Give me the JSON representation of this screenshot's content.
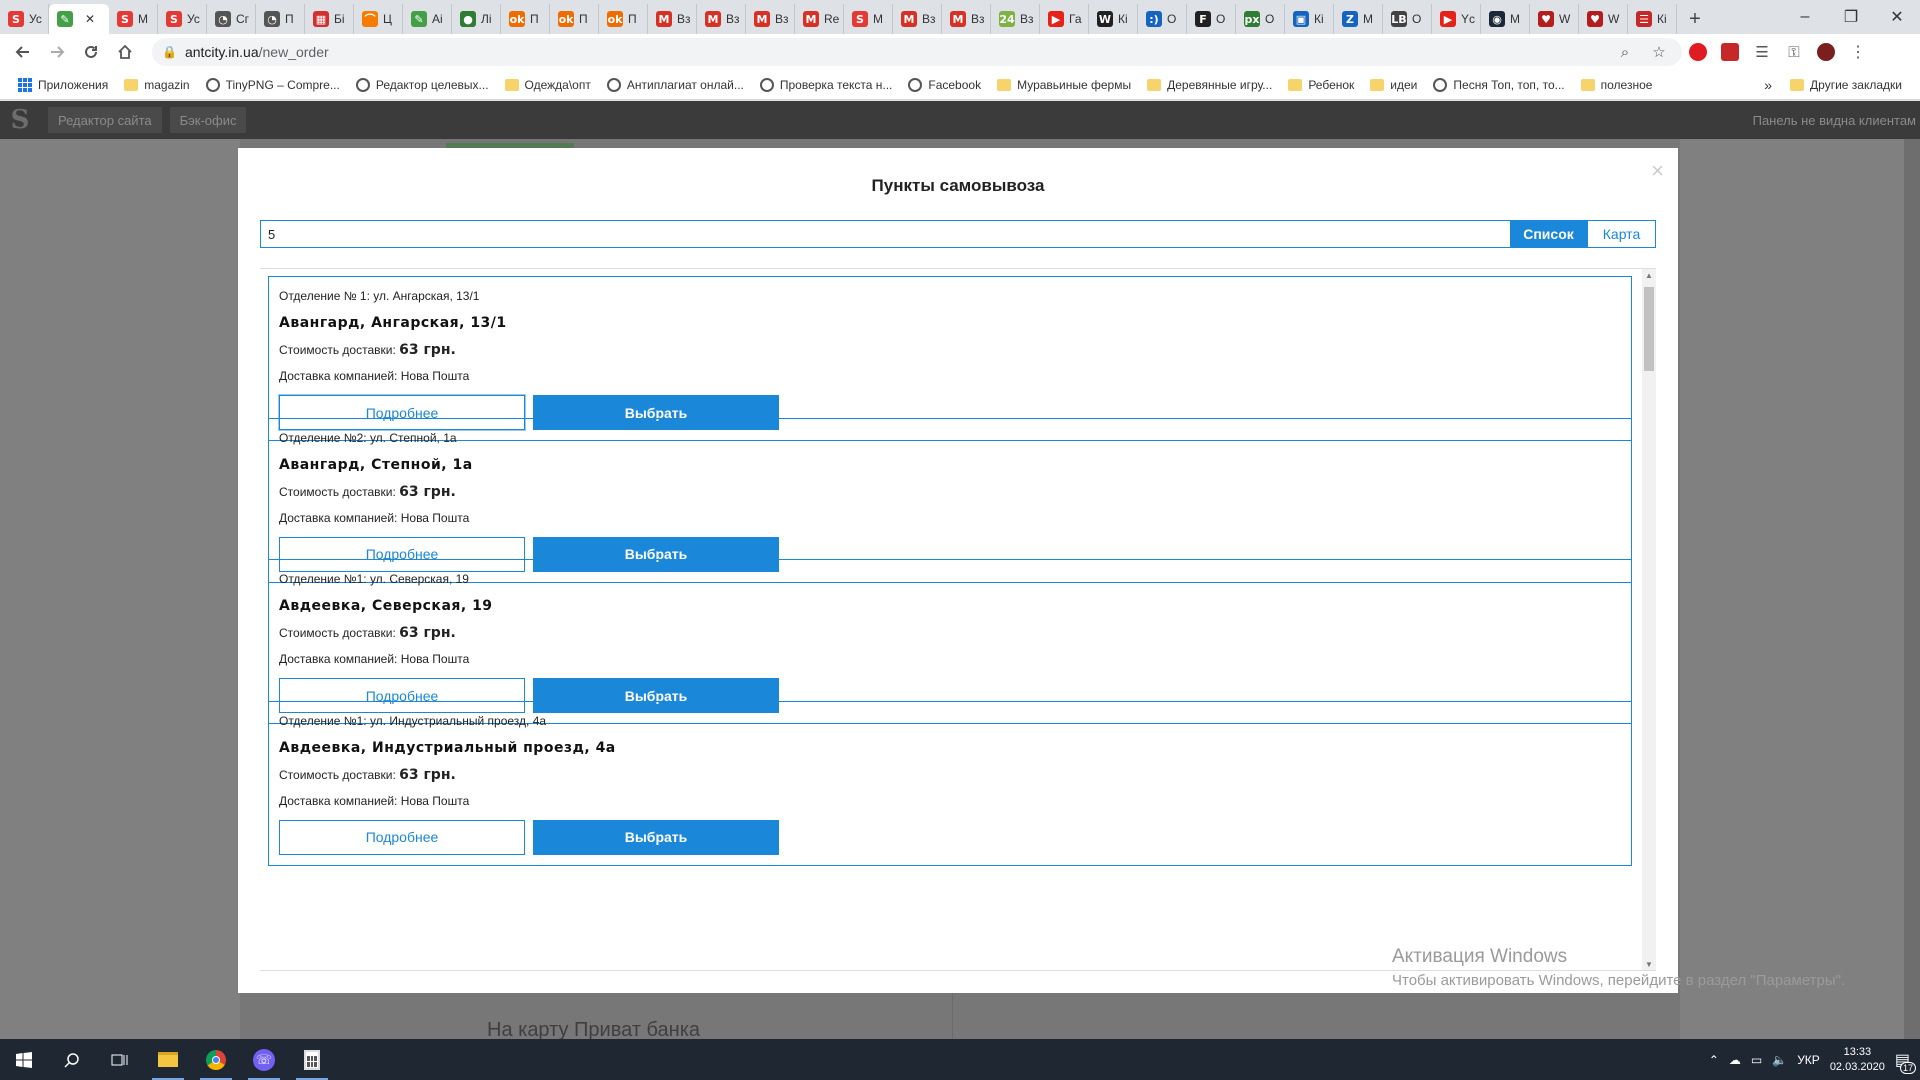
{
  "browser": {
    "tabs": [
      {
        "label": "Ус",
        "color": "#e53935",
        "glyph": "S"
      },
      {
        "label": "",
        "color": "#43a047",
        "glyph": "✎",
        "active": true
      },
      {
        "label": "М",
        "color": "#e53935",
        "glyph": "S"
      },
      {
        "label": "Ус",
        "color": "#e53935",
        "glyph": "S"
      },
      {
        "label": "Сг",
        "color": "#555555",
        "glyph": "◔"
      },
      {
        "label": "П",
        "color": "#555555",
        "glyph": "◔"
      },
      {
        "label": "Бі",
        "color": "#d32f2f",
        "glyph": "▦"
      },
      {
        "label": "Ц",
        "color": "#f57c00",
        "glyph": "⌒"
      },
      {
        "label": "Аі",
        "color": "#43a047",
        "glyph": "✎"
      },
      {
        "label": "Лі",
        "color": "#2e7d32",
        "glyph": "●"
      },
      {
        "label": "П",
        "color": "#ef6c00",
        "glyph": "ok"
      },
      {
        "label": "П",
        "color": "#ef6c00",
        "glyph": "ok"
      },
      {
        "label": "П",
        "color": "#ef6c00",
        "glyph": "ok"
      },
      {
        "label": "Вз",
        "color": "#d93025",
        "glyph": "M"
      },
      {
        "label": "Вз",
        "color": "#d93025",
        "glyph": "M"
      },
      {
        "label": "Вз",
        "color": "#d93025",
        "glyph": "M"
      },
      {
        "label": "Re",
        "color": "#d93025",
        "glyph": "M"
      },
      {
        "label": "М",
        "color": "#e53935",
        "glyph": "S"
      },
      {
        "label": "Вз",
        "color": "#d93025",
        "glyph": "M"
      },
      {
        "label": "Вз",
        "color": "#d93025",
        "glyph": "M"
      },
      {
        "label": "Вз",
        "color": "#7cb342",
        "glyph": "24"
      },
      {
        "label": "Га",
        "color": "#e62117",
        "glyph": "▶"
      },
      {
        "label": "Кі",
        "color": "#212121",
        "glyph": "W"
      },
      {
        "label": "О",
        "color": "#1565c0",
        "glyph": ":)"
      },
      {
        "label": "О",
        "color": "#212121",
        "glyph": "F"
      },
      {
        "label": "О",
        "color": "#2e7d32",
        "glyph": "px"
      },
      {
        "label": "Кі",
        "color": "#1565c0",
        "glyph": "▣"
      },
      {
        "label": "М",
        "color": "#1565c0",
        "glyph": "Z"
      },
      {
        "label": "О",
        "color": "#424242",
        "glyph": "LB"
      },
      {
        "label": "Yc",
        "color": "#e62117",
        "glyph": "▶"
      },
      {
        "label": "М",
        "color": "#1b2838",
        "glyph": "◉"
      },
      {
        "label": "W",
        "color": "#b71c1c",
        "glyph": "♥"
      },
      {
        "label": "W",
        "color": "#b71c1c",
        "glyph": "♥"
      },
      {
        "label": "Кі",
        "color": "#c62828",
        "glyph": "☰"
      }
    ],
    "window_controls": [
      "–",
      "❐",
      "✕"
    ],
    "url_domain": "antcity.in.ua",
    "url_path": "/new_order",
    "bookmarks": [
      {
        "label": "Приложения",
        "kind": "apps"
      },
      {
        "label": "magazin",
        "kind": "folder"
      },
      {
        "label": "TinyPNG – Compre...",
        "kind": "globe"
      },
      {
        "label": "Редактор целевых...",
        "kind": "globe"
      },
      {
        "label": "Одежда\\опт",
        "kind": "folder"
      },
      {
        "label": "Антиплагиат онлай...",
        "kind": "globe"
      },
      {
        "label": "Проверка текста н...",
        "kind": "globe"
      },
      {
        "label": "Facebook",
        "kind": "globe"
      },
      {
        "label": "Муравьиные фермы",
        "kind": "folder"
      },
      {
        "label": "Деревянные игру...",
        "kind": "folder"
      },
      {
        "label": "Ребенок",
        "kind": "folder"
      },
      {
        "label": "идеи",
        "kind": "folder"
      },
      {
        "label": "Песня Топ, топ, то...",
        "kind": "globe"
      },
      {
        "label": "полезное",
        "kind": "folder"
      }
    ],
    "bookmarks_more": "»",
    "other_bookmarks": "Другие закладки"
  },
  "admin_bar": {
    "logo": "S",
    "links": [
      "Редактор сайта",
      "Бэк-офис"
    ],
    "note": "Панель не видна клиентам"
  },
  "background": {
    "bank_link": "На карту Приват банка"
  },
  "modal": {
    "title": "Пункты самовывоза",
    "close": "×",
    "search_value": "5",
    "view_list": "Список",
    "view_map": "Карта",
    "cost_label": "Стоимость доставки:",
    "more_label": "Подробнее",
    "pick_label": "Выбрать",
    "points": [
      {
        "dept": "Отделение № 1: ул. Ангарская, 13/1",
        "title": "Авангард, Ангарская, 13/1",
        "cost": "63 грн.",
        "company": "Доставка компанией: Нова Пошта"
      },
      {
        "dept": "Отделение №2: ул. Степной, 1а",
        "title": "Авангард, Степной, 1а",
        "cost": "63 грн.",
        "company": "Доставка компанией: Нова Пошта"
      },
      {
        "dept": "Отделение №1: ул. Северская, 19",
        "title": "Авдеевка, Северская, 19",
        "cost": "63 грн.",
        "company": "Доставка компанией: Нова Пошта"
      },
      {
        "dept": "Отделение №1: ул. Индустриальный проезд, 4а",
        "title": "Авдеевка, Индустриальный проезд, 4а",
        "cost": "63 грн.",
        "company": "Доставка компанией: Нова Пошта"
      }
    ]
  },
  "windows_activation": {
    "title": "Активация Windows",
    "message": "Чтобы активировать Windows, перейдите в раздел \"Параметры\"."
  },
  "taskbar": {
    "tray_lang": "УКР",
    "time": "13:33",
    "date": "02.03.2020",
    "notif_count": "17"
  }
}
